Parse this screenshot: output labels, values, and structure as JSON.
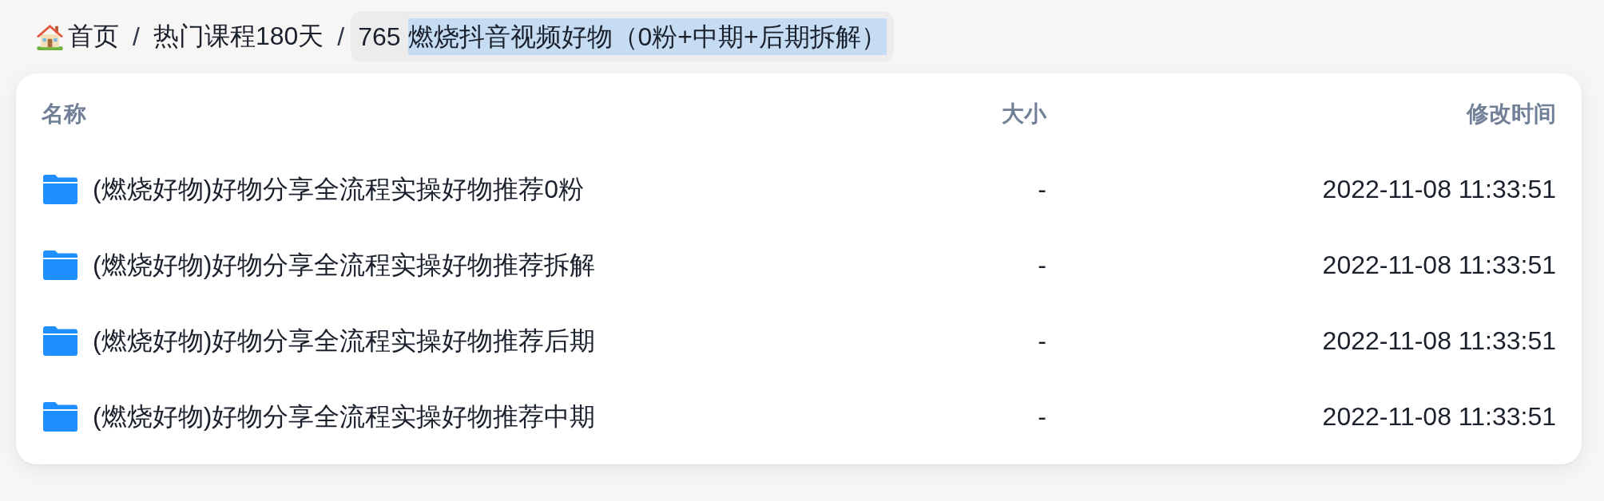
{
  "breadcrumb": {
    "items": [
      {
        "kind": "home",
        "label": "首页"
      },
      {
        "kind": "link",
        "separator": "/",
        "label": "热门课程180天"
      },
      {
        "kind": "current",
        "separator": "/",
        "number": "765",
        "title": "燃烧抖音视频好物（0粉+中期+后期拆解）",
        "highlighted": true
      }
    ]
  },
  "table": {
    "columns": [
      "名称",
      "大小",
      "修改时间"
    ],
    "rows": [
      {
        "kind": "folder",
        "name": "(燃烧好物)好物分享全流程实操好物推荐0粉",
        "size": "-",
        "modified": "2022-11-08 11:33:51"
      },
      {
        "kind": "folder",
        "name": "(燃烧好物)好物分享全流程实操好物推荐拆解",
        "size": "-",
        "modified": "2022-11-08 11:33:51"
      },
      {
        "kind": "folder",
        "name": "(燃烧好物)好物分享全流程实操好物推荐后期",
        "size": "-",
        "modified": "2022-11-08 11:33:51"
      },
      {
        "kind": "folder",
        "name": "(燃烧好物)好物分享全流程实操好物推荐中期",
        "size": "-",
        "modified": "2022-11-08 11:33:51"
      }
    ]
  }
}
